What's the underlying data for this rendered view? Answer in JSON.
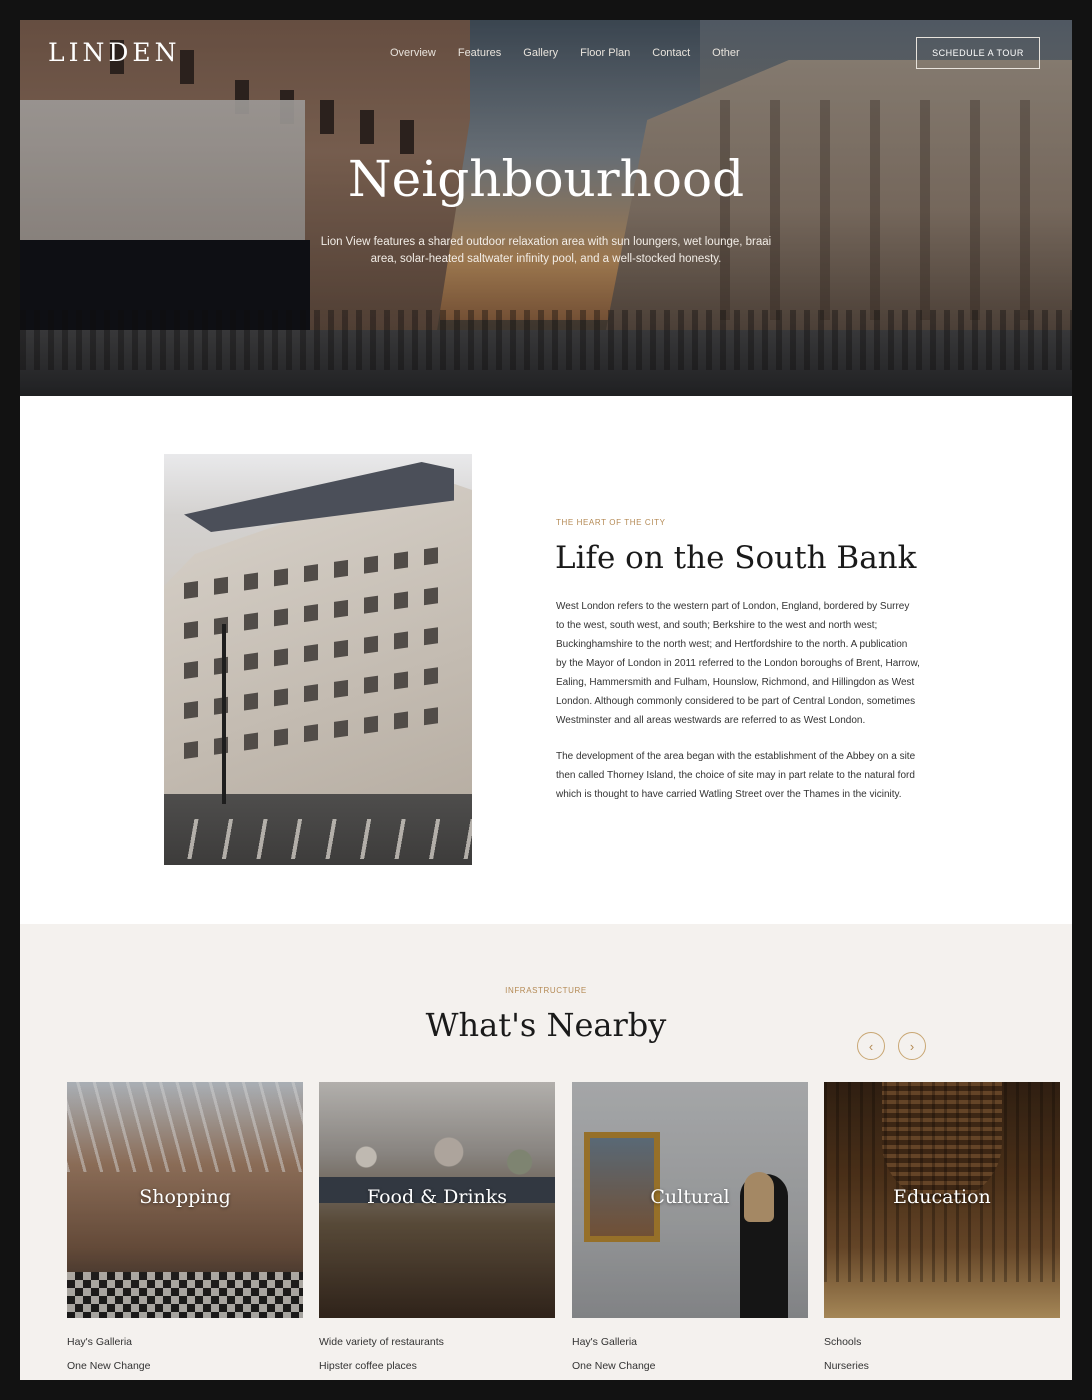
{
  "brand": {
    "logo": "LINDEN"
  },
  "nav": {
    "items": [
      "Overview",
      "Features",
      "Gallery",
      "Floor Plan",
      "Contact",
      "Other"
    ],
    "cta": "SCHEDULE A TOUR"
  },
  "hero": {
    "title": "Neighbourhood",
    "subtitle": "Lion View features a shared outdoor relaxation area with sun loungers, wet lounge, braai area, solar-heated saltwater infinity pool, and a well-stocked honesty."
  },
  "about": {
    "eyebrow": "THE HEART OF THE CITY",
    "title": "Life on the South Bank",
    "paragraphs": [
      "West London refers to the western part of London, England, bordered by Surrey to the west, south west, and south; Berkshire to the west and north west; Buckinghamshire to the north west; and Hertfordshire to the north. A publication by the Mayor of London in 2011 referred to the London boroughs of Brent, Harrow, Ealing, Hammersmith and Fulham, Hounslow, Richmond, and Hillingdon as West London. Although commonly considered to be part of Central London, sometimes Westminster and all areas westwards are referred to as West London.",
      "The development of the area began with the establishment of the Abbey on a site then called Thorney Island, the choice of site may in part relate to the natural ford which is thought to have carried Watling Street over the Thames in the vicinity."
    ]
  },
  "nearby": {
    "eyebrow": "INFRASTRUCTURE",
    "title": "What's Nearby",
    "prev_icon": "chevron-left-icon",
    "next_icon": "chevron-right-icon",
    "cards": [
      {
        "label": "Shopping",
        "items": [
          "Hay's Galleria",
          "One New Change"
        ]
      },
      {
        "label": "Food & Drinks",
        "items": [
          "Wide variety of restaurants",
          "Hipster coffee places"
        ]
      },
      {
        "label": "Cultural",
        "items": [
          "Hay's Galleria",
          "One New Change"
        ]
      },
      {
        "label": "Education",
        "items": [
          "Schools",
          "Nurseries"
        ]
      }
    ]
  },
  "colors": {
    "accent": "#b48a55",
    "section_bg": "#f4f1ee",
    "text": "#1a1a1a"
  }
}
